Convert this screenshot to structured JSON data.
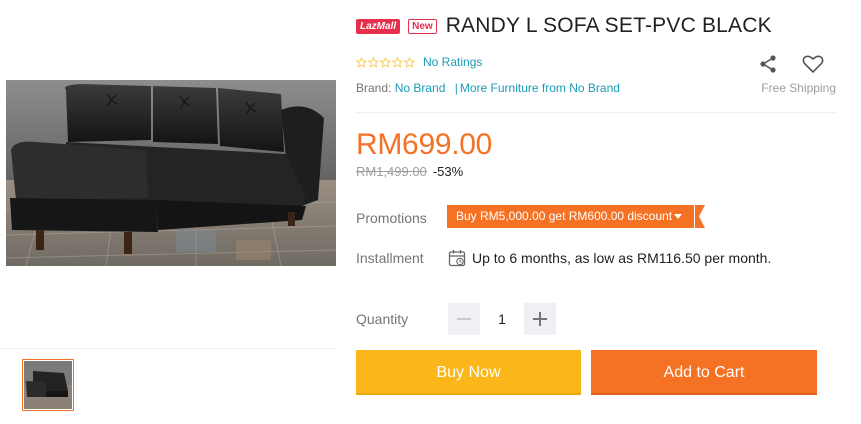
{
  "product": {
    "badges": {
      "lazmall": "LazMall",
      "new": "New"
    },
    "title": "RANDY L SOFA SET-PVC BLACK",
    "rating_text": "No Ratings",
    "brand_label": "Brand:",
    "brand_value": "No Brand",
    "brand_separator": "|",
    "more_link": "More Furniture from No Brand",
    "free_shipping": "Free Shipping"
  },
  "price": {
    "current": "RM699.00",
    "original": "RM1,499.00",
    "discount": "-53%"
  },
  "promotions": {
    "label": "Promotions",
    "tag": "Buy RM5,000.00 get RM600.00 discount"
  },
  "installment": {
    "label": "Installment",
    "text": "Up to 6 months, as low as RM116.50 per month."
  },
  "quantity": {
    "label": "Quantity",
    "value": "1"
  },
  "buttons": {
    "buy_now": "Buy Now",
    "add_to_cart": "Add to Cart"
  },
  "icons": {
    "share": "share-icon",
    "wishlist": "heart-icon",
    "calendar": "calendar-icon",
    "rating": "star-icon"
  },
  "colors": {
    "accent": "#f57224",
    "buy_now": "#fbb61a",
    "link": "#1a9cb7",
    "lazmall": "#e62e4d"
  }
}
